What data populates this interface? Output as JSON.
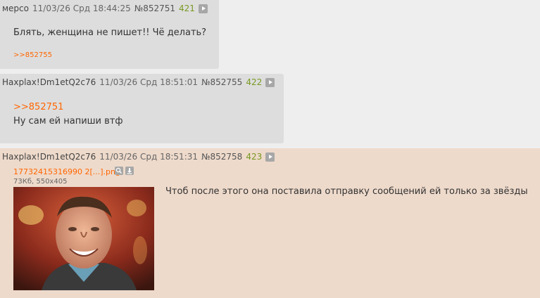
{
  "posts": [
    {
      "name": "мерсо",
      "date": "11/03/26 Срд 18:44:25",
      "number": "№852751",
      "count": "421",
      "message": "Блять, женщина не пишет!! Чё делать?",
      "reply_link": ">>852755"
    },
    {
      "name": "Haxplax!Dm1etQ2c76",
      "date": "11/03/26 Срд 18:51:01",
      "number": "№852755",
      "count": "422",
      "quote_link": ">>852751",
      "message": "Ну сам ей напиши втф"
    },
    {
      "name": "Haxplax!Dm1etQ2c76",
      "date": "11/03/26 Срд 18:51:31",
      "number": "№852758",
      "count": "423",
      "file_name": "17732415316990 2[...].png",
      "file_meta": "73Кб, 550x405",
      "message": "Чтоб после этого она поставила отправку сообщений ей только за звёзды"
    }
  ],
  "colors": {
    "link": "#ff6600",
    "count": "#789922",
    "highlight": "#eedacb"
  },
  "icons": {
    "reply": "play-icon",
    "search": "search-icon",
    "download": "download-icon"
  }
}
